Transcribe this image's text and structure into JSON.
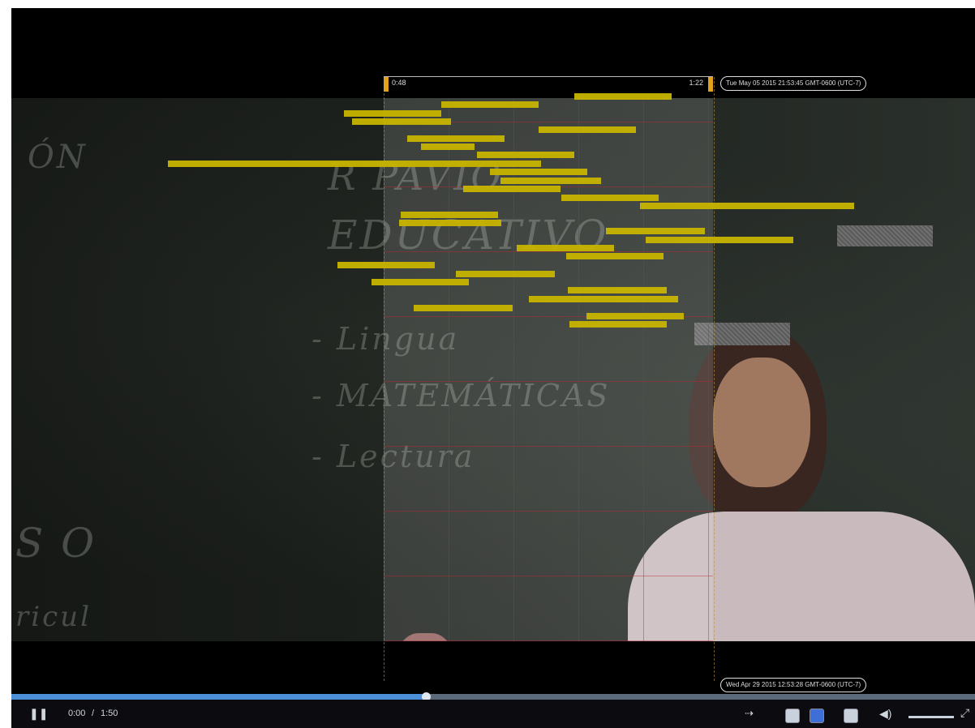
{
  "player": {
    "window_start_label": "0:48",
    "window_end_label": "1:22",
    "top_date_label": "Tue May 05 2015 21:53:45 GMT-0600 (UTC-7)",
    "bottom_date_label": "Wed Apr 29 2015 12:53:28 GMT-0600 (UTC-7)",
    "current_time": "0:00",
    "time_separator": "/",
    "duration": "1:50",
    "progress_fraction": 0.43,
    "annotation_color": "#c8b400",
    "accent_color": "#4a8fd8"
  },
  "board_text": {
    "line1": "ÓN",
    "line2": "R  PAVIO",
    "line3": "EDUCATIVO",
    "line4": "- Lingua",
    "line5": "- MATEMÁTICAS",
    "line6": "- Lectura",
    "line7": "S O",
    "line8": "ricul"
  },
  "controls": {
    "play_pause_icon": "pause-icon",
    "speed_icon": "speed-icon",
    "volume_icon": "volume-icon",
    "fullscreen_icon": "fullscreen-icon",
    "volume_level": 0.8
  }
}
